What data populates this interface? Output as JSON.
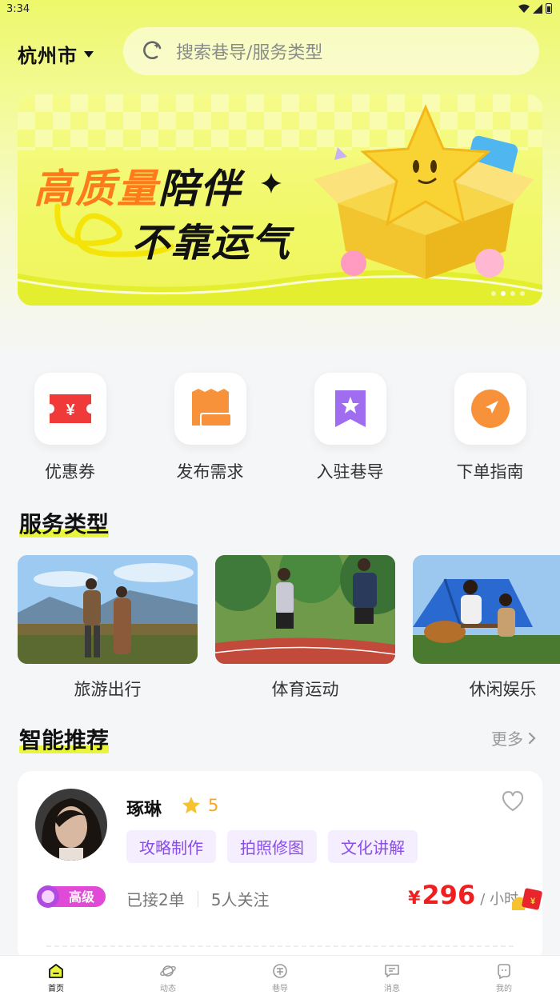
{
  "status_bar": {
    "time": "3:34"
  },
  "header": {
    "city": "杭州市",
    "search_placeholder": "搜索巷导/服务类型"
  },
  "banner": {
    "line1_orange": "高质量",
    "line1_black": "陪伴",
    "line2": "不靠运气",
    "active_slide": 2,
    "slide_count": 4
  },
  "quick_actions": [
    {
      "label": "优惠券",
      "icon": "coupon-icon"
    },
    {
      "label": "发布需求",
      "icon": "receipt-icon"
    },
    {
      "label": "入驻巷导",
      "icon": "bookmark-star-icon"
    },
    {
      "label": "下单指南",
      "icon": "navigation-arrow-icon"
    }
  ],
  "services": {
    "title": "服务类型",
    "items": [
      {
        "label": "旅游出行"
      },
      {
        "label": "体育运动"
      },
      {
        "label": "休闲娱乐"
      }
    ]
  },
  "recommend": {
    "title": "智能推荐",
    "more": "更多",
    "card": {
      "name": "琢琳",
      "rating": "5",
      "tags": [
        "攻略制作",
        "拍照修图",
        "文化讲解"
      ],
      "level": "高级",
      "orders": "已接2单",
      "followers": "5人关注",
      "currency": "¥",
      "price": "296",
      "unit": "/ 小时"
    }
  },
  "bottom_nav": [
    {
      "label": "首页",
      "icon": "home-icon",
      "active": true
    },
    {
      "label": "动态",
      "icon": "planet-icon",
      "active": false
    },
    {
      "label": "巷导",
      "icon": "guide-icon",
      "active": false
    },
    {
      "label": "消息",
      "icon": "message-icon",
      "active": false
    },
    {
      "label": "我的",
      "icon": "profile-icon",
      "active": false
    }
  ],
  "colors": {
    "accent_yellow": "#e8f53b",
    "price_red": "#f01e1e",
    "tag_purple": "#8a4ee8",
    "rating_orange": "#f5a623"
  }
}
